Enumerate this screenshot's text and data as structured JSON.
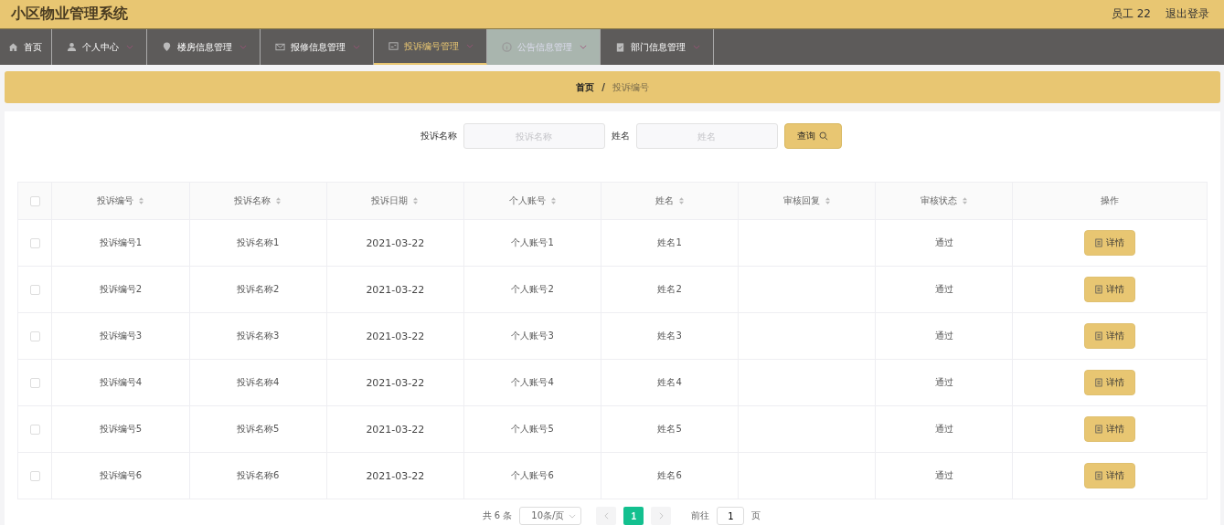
{
  "header": {
    "title": "小区物业管理系统",
    "user": "员工 22",
    "logout": "退出登录"
  },
  "nav": [
    {
      "label": "首页",
      "kind": "home",
      "selected": false,
      "hovered": false,
      "dropdown": false
    },
    {
      "label": "个人中心",
      "kind": "user",
      "selected": false,
      "hovered": false,
      "dropdown": true
    },
    {
      "label": "楼房信息管理",
      "kind": "pin",
      "selected": false,
      "hovered": false,
      "dropdown": true
    },
    {
      "label": "报修信息管理",
      "kind": "mail",
      "selected": false,
      "hovered": false,
      "dropdown": true
    },
    {
      "label": "投诉编号管理",
      "kind": "card",
      "selected": true,
      "hovered": false,
      "dropdown": true
    },
    {
      "label": "公告信息管理",
      "kind": "info",
      "selected": false,
      "hovered": true,
      "dropdown": true
    },
    {
      "label": "部门信息管理",
      "kind": "clipboard",
      "selected": false,
      "hovered": false,
      "dropdown": true
    }
  ],
  "breadcrumb": {
    "home": "首页",
    "separator": "/",
    "current": "投诉编号"
  },
  "search": {
    "fields": [
      {
        "label": "投诉名称",
        "placeholder": "投诉名称"
      },
      {
        "label": "姓名",
        "placeholder": "姓名"
      }
    ],
    "button": "查询"
  },
  "table": {
    "columns": [
      {
        "label": "投诉编号",
        "sortable": true
      },
      {
        "label": "投诉名称",
        "sortable": true
      },
      {
        "label": "投诉日期",
        "sortable": true
      },
      {
        "label": "个人账号",
        "sortable": true
      },
      {
        "label": "姓名",
        "sortable": true
      },
      {
        "label": "审核回复",
        "sortable": true
      },
      {
        "label": "审核状态",
        "sortable": true
      },
      {
        "label": "操作",
        "sortable": false
      }
    ],
    "header_checked": false,
    "rows": [
      {
        "checked": false,
        "cells": [
          "投诉编号1",
          "投诉名称1",
          "2021-03-22",
          "个人账号1",
          "姓名1",
          "",
          "通过"
        ],
        "action": "详情"
      },
      {
        "checked": false,
        "cells": [
          "投诉编号2",
          "投诉名称2",
          "2021-03-22",
          "个人账号2",
          "姓名2",
          "",
          "通过"
        ],
        "action": "详情"
      },
      {
        "checked": false,
        "cells": [
          "投诉编号3",
          "投诉名称3",
          "2021-03-22",
          "个人账号3",
          "姓名3",
          "",
          "通过"
        ],
        "action": "详情"
      },
      {
        "checked": false,
        "cells": [
          "投诉编号4",
          "投诉名称4",
          "2021-03-22",
          "个人账号4",
          "姓名4",
          "",
          "通过"
        ],
        "action": "详情"
      },
      {
        "checked": false,
        "cells": [
          "投诉编号5",
          "投诉名称5",
          "2021-03-22",
          "个人账号5",
          "姓名5",
          "",
          "通过"
        ],
        "action": "详情"
      },
      {
        "checked": false,
        "cells": [
          "投诉编号6",
          "投诉名称6",
          "2021-03-22",
          "个人账号6",
          "姓名6",
          "",
          "通过"
        ],
        "action": "详情"
      }
    ]
  },
  "pagination": {
    "total": "共 6 条",
    "page_size": "10条/页",
    "pages": [
      {
        "label": "1",
        "selected": true
      }
    ],
    "goto_label": "前往",
    "goto_value": "1",
    "goto_suffix": "页"
  }
}
